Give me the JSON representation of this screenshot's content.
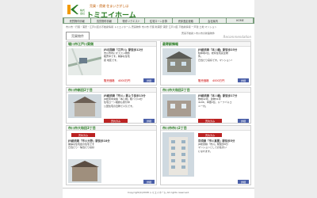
{
  "header": {
    "tagline": "売買・賃貸 住まいさがしは",
    "brand": "トミエイホーム",
    "brand_small": "株式会社"
  },
  "nav": [
    "売買物件情報",
    "賃貸物件情報",
    "物件リクエスト",
    "住宅ローン計算",
    "売却査定依頼",
    "会社案内",
    "HOME"
  ],
  "breadcrumb": "市川市・行徳・浦安・江戸川区の不動産情報 トミエイホーム 売買物件 市川市 行徳 新浦安 浦安 江戸川区 不動産情報 一戸建 土地 マンション",
  "section": {
    "tab": "売買物件",
    "path": "売買不動産＞市川市の新築物件",
    "recommend": "Recommendation"
  },
  "cards": [
    {
      "title": "堀川市江戸川東側",
      "price_title": "JR北国線「江戸川」駅徒歩12分",
      "lines": [
        "市川市内にオススメ物件",
        "販売中です。閑静な住宅",
        "街 地区です。"
      ],
      "price": "販売価格 　4000万円",
      "link": "詳細"
    },
    {
      "title": "最寄駅情報",
      "price_title": "JR総武線「本八幡」駅徒歩25分",
      "lines": [
        "駐車場2台、総有住宅完全物",
        "件。",
        "日当たり良好です。マンション!"
      ],
      "price": "販売価格 　4000万円",
      "link": "詳細"
    },
    {
      "title": "市川市新田2丁目",
      "price_title": "JR総武線「市川」駅より徒歩13分",
      "lines": [
        "JR総武中央線「本八幡」駅バス14分",
        "住宅ローン相談も受付中",
        "公団住宅の近隣で人気です。"
      ],
      "price": "",
      "sold": "売約済み",
      "link": "詳細"
    },
    {
      "title": "市川市大和田2丁目",
      "price_title": "JR総武線「本八幡」駅徒歩17分",
      "lines": [
        "敷地42坪、建物31坪",
        "4LDK、車庫2台、ルーフバルコ",
        "ニー付。"
      ],
      "price": "",
      "sold": "売約済み",
      "link": "詳細"
    },
    {
      "title": "市川市大和田3丁目",
      "price_title": "JR総武線「市川大野」駅徒歩18分",
      "lines": [
        "閑静な住宅街の住宅です",
        "日当たり・陽当たり良好"
      ],
      "price": "",
      "sold": "売約済み",
      "link": "詳細"
    },
    {
      "title": "市川市市川2丁目",
      "price_title": "京成線「市川真間」駅徒歩5分",
      "lines": [
        "JR総武線「市川」駅徒歩8分",
        "マンションとしてお住まい",
        "になれます。"
      ],
      "price": "",
      "sold": "売約済み",
      "link": "詳細"
    }
  ],
  "footer": {
    "copyright": "Copyright(C)2008 トミエイホーム All rights reserved."
  }
}
